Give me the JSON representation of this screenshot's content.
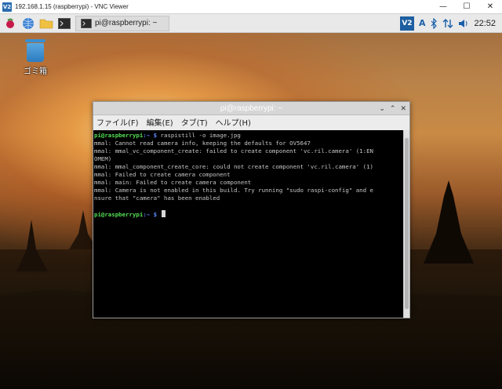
{
  "vnc": {
    "logo": "V2",
    "title": "192.168.1.15 (raspberrypi) - VNC Viewer",
    "controls": {
      "minimize": "—",
      "maximize": "☐",
      "close": "✕"
    }
  },
  "taskbar": {
    "task_label": "pi@raspberrypi: ~",
    "tray": {
      "vnc": "V2",
      "lang": "A",
      "clock": "22:52"
    }
  },
  "desktop": {
    "trash_label": "ゴミ箱"
  },
  "terminal": {
    "title": "pi@raspberrypi: ~",
    "buttons": {
      "minimize": "⌄",
      "maximize": "⌃",
      "close": "✕"
    },
    "menu": [
      "ファイル(F)",
      "編集(E)",
      "タブ(T)",
      "ヘルプ(H)"
    ],
    "prompt_user": "pi@raspberrypi",
    "prompt_path": ":~ $ ",
    "command": "raspistill -o image.jpg",
    "output": [
      "mmal: Cannot read camera info, keeping the defaults for OV5647",
      "mmal: mmal_vc_component_create: failed to create component 'vc.ril.camera' (1:EN",
      "OMEM)",
      "mmal: mmal_component_create_core: could not create component 'vc.ril.camera' (1)",
      "mmal: Failed to create camera component",
      "mmal: main: Failed to create camera component",
      "mmal: Camera is not enabled in this build. Try running \"sudo raspi-config\" and e",
      "nsure that \"camera\" has been enabled"
    ]
  },
  "colors": {
    "prompt_user": "#55e055",
    "prompt_path": "#5b8cff",
    "terminal_bg": "#000000",
    "terminal_text": "#c6c6c6"
  }
}
